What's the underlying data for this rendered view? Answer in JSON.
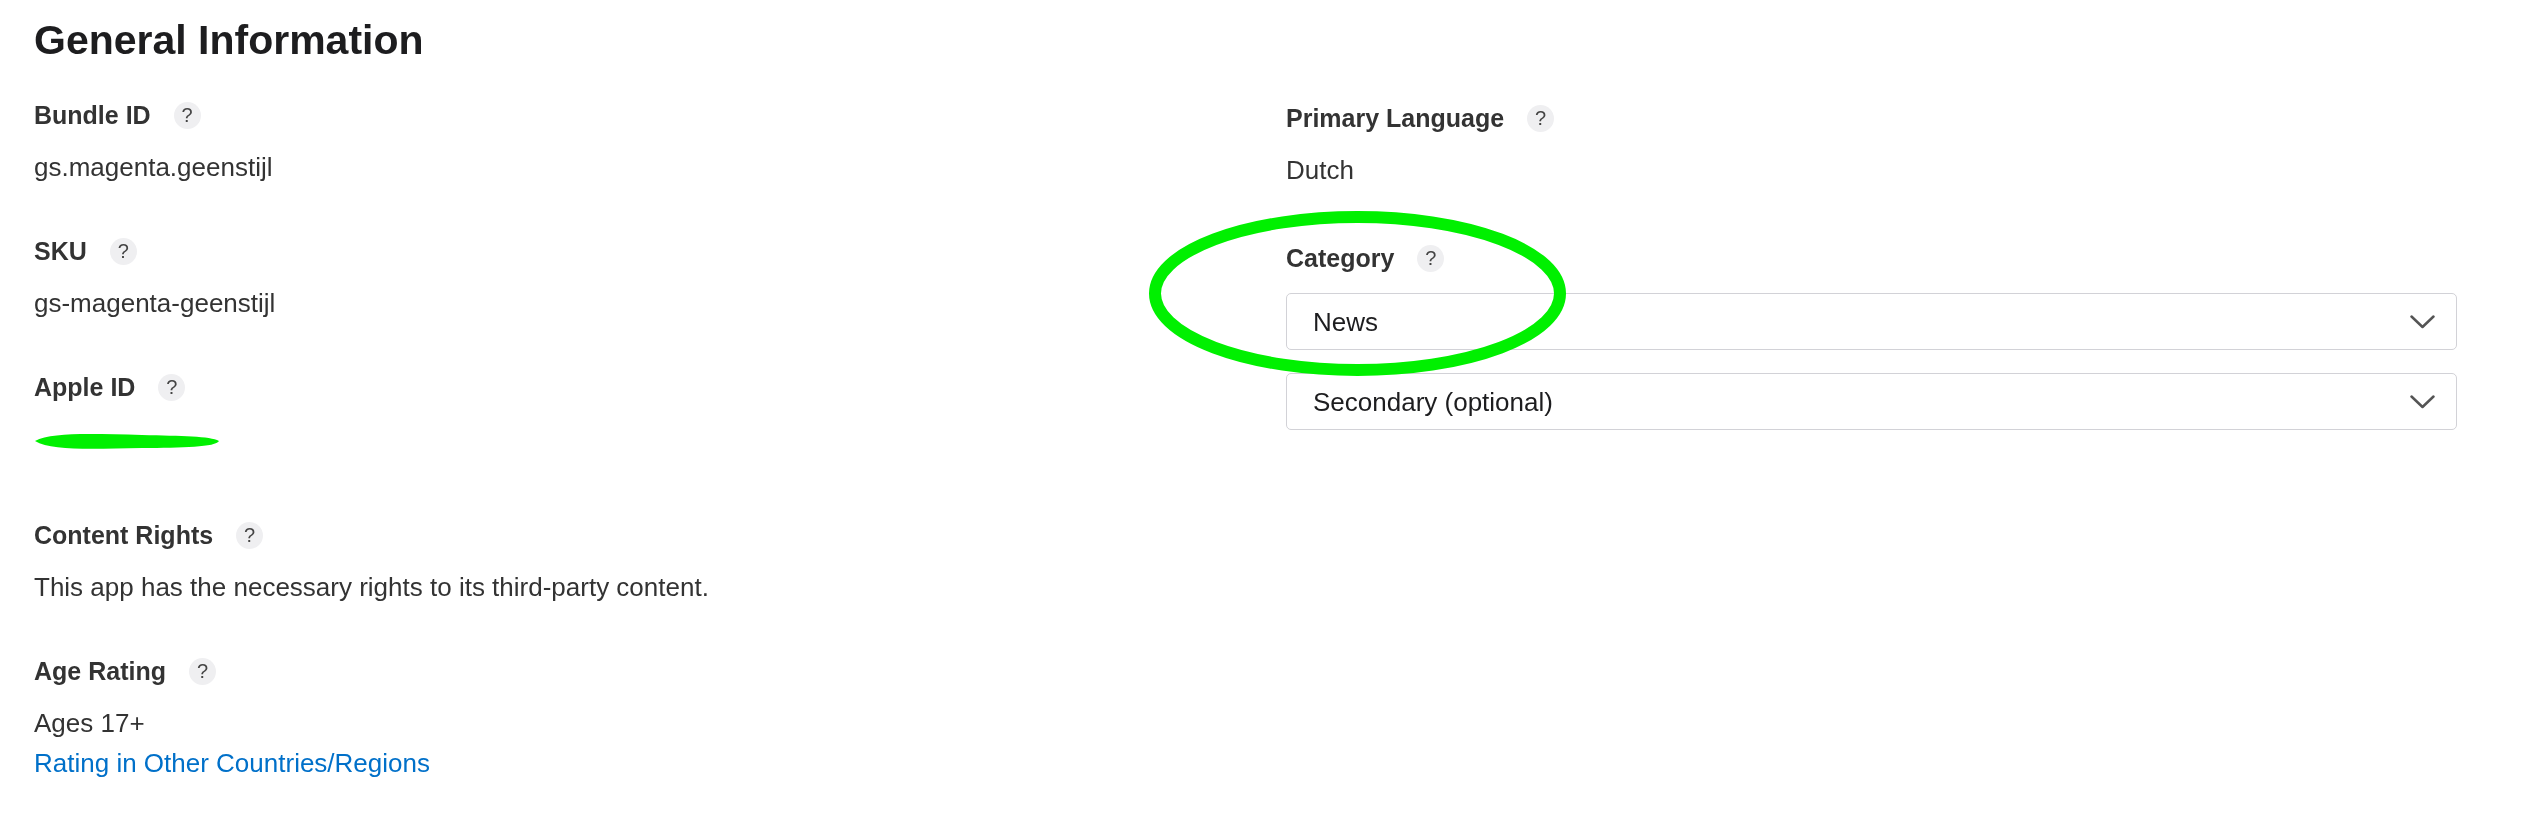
{
  "heading": "General Information",
  "left_fields": [
    {
      "label": "Bundle ID",
      "help": "?",
      "value": "gs.magenta.geenstijl"
    },
    {
      "label": "SKU",
      "help": "?",
      "value": "gs-magenta-geenstijl"
    },
    {
      "label": "Apple ID",
      "help": "?",
      "redacted": true
    },
    {
      "label": "Content Rights",
      "help": "?",
      "value": "This app has the necessary rights to its third-party content."
    },
    {
      "label": "Age Rating",
      "help": "?",
      "value": "Ages 17+",
      "link": "Rating in Other Countries/Regions"
    }
  ],
  "right_fields": [
    {
      "label": "Primary Language",
      "help": "?",
      "value": "Dutch"
    },
    {
      "label": "Category",
      "help": "?",
      "circled": true,
      "selects": [
        {
          "value": "News"
        },
        {
          "value": "Secondary (optional)"
        }
      ]
    }
  ]
}
